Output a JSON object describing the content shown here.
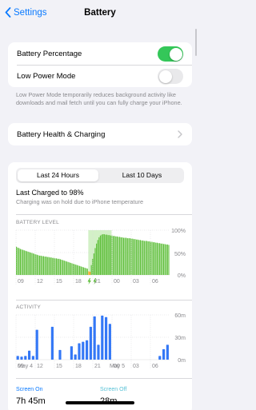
{
  "nav": {
    "back_label": "Settings",
    "title": "Battery"
  },
  "settings": {
    "battery_percentage": {
      "label": "Battery Percentage",
      "on": true
    },
    "low_power_mode": {
      "label": "Low Power Mode",
      "on": false,
      "footnote": "Low Power Mode temporarily reduces background activity like downloads and mail fetch until you can fully charge your iPhone."
    },
    "health_label": "Battery Health & Charging"
  },
  "usage": {
    "tabs": [
      "Last 24 Hours",
      "Last 10 Days"
    ],
    "selected_tab": "Last 24 Hours",
    "last_charged": "Last Charged to 98%",
    "charging_note": "Charging was on hold due to iPhone temperature",
    "battery_level_label": "BATTERY LEVEL",
    "activity_label": "ACTIVITY",
    "x_ticks": [
      "09",
      "12",
      "15",
      "18",
      "21",
      "00",
      "03",
      "06"
    ],
    "battery_y_ticks": [
      "100%",
      "50%",
      "0%"
    ],
    "activity_y_ticks": [
      "60m",
      "30m",
      "0m"
    ],
    "dates": [
      "May 4",
      "May 5"
    ],
    "screen_on_label": "Screen On",
    "screen_on_value": "7h 45m",
    "screen_off_label": "Screen Off",
    "screen_off_value": "28m"
  },
  "colors": {
    "accent": "#0a7aff",
    "battery_bar": "#5fbf3b",
    "charging_bg": "#d3f0c7",
    "low_battery": "#ff9500",
    "activity_bar": "#3478f6",
    "toggle_on": "#34c759"
  },
  "chart_data": [
    {
      "type": "bar",
      "title": "BATTERY LEVEL",
      "x_ticks": [
        "09",
        "12",
        "15",
        "18",
        "21",
        "00",
        "03",
        "06"
      ],
      "ylim": [
        0,
        100
      ],
      "y_unit": "%",
      "values": [
        63,
        61,
        60,
        58,
        57,
        56,
        55,
        54,
        53,
        52,
        51,
        50,
        49,
        48,
        47,
        46,
        45,
        44,
        43,
        43,
        42,
        42,
        41,
        41,
        40,
        40,
        39,
        39,
        38,
        38,
        37,
        37,
        36,
        36,
        35,
        34,
        33,
        32,
        31,
        30,
        29,
        28,
        27,
        26,
        25,
        24,
        23,
        22,
        21,
        20,
        19,
        18,
        17,
        16,
        15,
        14,
        8,
        7,
        22,
        36,
        48,
        60,
        70,
        78,
        84,
        88,
        90,
        91,
        91,
        90,
        90,
        89,
        89,
        88,
        88,
        87,
        87,
        86,
        86,
        85,
        85,
        84,
        84,
        83,
        83,
        83,
        82,
        82,
        82,
        81,
        81,
        80,
        80,
        79,
        79,
        78,
        78,
        77,
        77,
        76,
        76,
        76,
        75,
        75,
        74,
        74,
        73,
        73,
        72,
        72,
        71,
        71,
        70,
        70,
        69,
        69,
        68,
        68,
        67
      ]
    },
    {
      "type": "bar",
      "title": "ACTIVITY",
      "x_ticks": [
        "09",
        "12",
        "15",
        "18",
        "21",
        "00",
        "03",
        "06"
      ],
      "ylim": [
        0,
        60
      ],
      "y_unit": "m",
      "values": [
        5,
        4,
        5,
        12,
        5,
        40,
        0,
        0,
        0,
        44,
        0,
        13,
        0,
        0,
        18,
        7,
        22,
        24,
        26,
        44,
        58,
        20,
        59,
        57,
        48,
        0,
        0,
        0,
        0,
        0,
        0,
        0,
        0,
        0,
        0,
        0,
        0,
        5,
        14,
        20
      ]
    }
  ]
}
